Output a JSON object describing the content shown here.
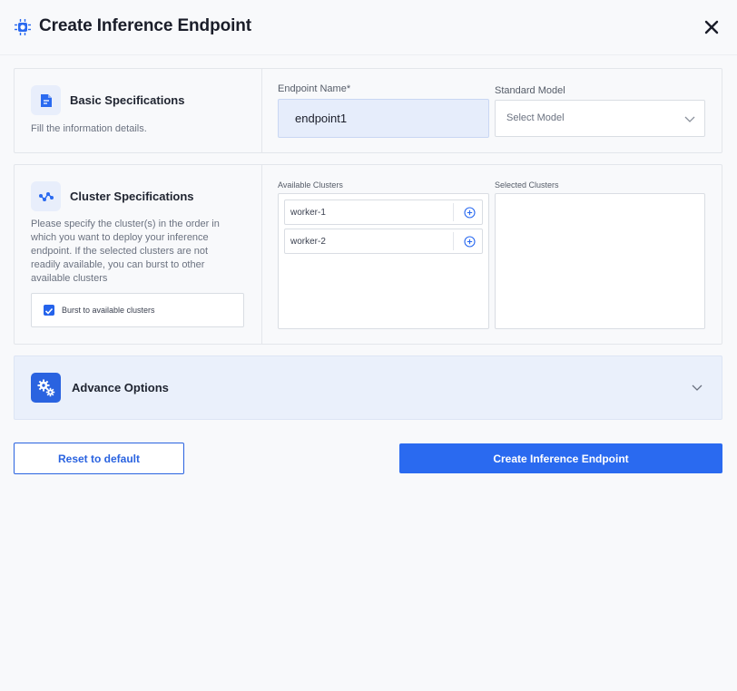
{
  "header": {
    "title": "Create Inference Endpoint",
    "logo_icon": "chip-icon",
    "close_icon": "close-icon"
  },
  "basic": {
    "title": "Basic Specifications",
    "description": "Fill the information details.",
    "icon": "document-icon",
    "endpoint_name_label": "Endpoint Name*",
    "endpoint_name_value": "endpoint1",
    "standard_model_label": "Standard Model",
    "standard_model_placeholder": "Select Model"
  },
  "cluster": {
    "title": "Cluster Specifications",
    "icon": "network-icon",
    "description_lines": [
      "Please specify the cluster(s) in the order in",
      "which you want to deploy your inference",
      "endpoint. If the selected clusters are not",
      "readily available, you can burst to other",
      "available clusters"
    ],
    "burst_label": "Burst to available clusters",
    "burst_checked": true,
    "available_label": "Available Clusters",
    "selected_label": "Selected Clusters",
    "available": [
      {
        "name": "worker-1"
      },
      {
        "name": "worker-2"
      }
    ],
    "selected": []
  },
  "advance": {
    "label": "Advance Options",
    "icon": "gears-icon"
  },
  "actions": {
    "reset_label": "Reset to default",
    "create_label": "Create Inference Endpoint"
  },
  "colors": {
    "accent": "#2a6af0",
    "background": "#f8f9fb",
    "input_active": "#e6edfb",
    "advance_bg": "#eaf0fb"
  }
}
